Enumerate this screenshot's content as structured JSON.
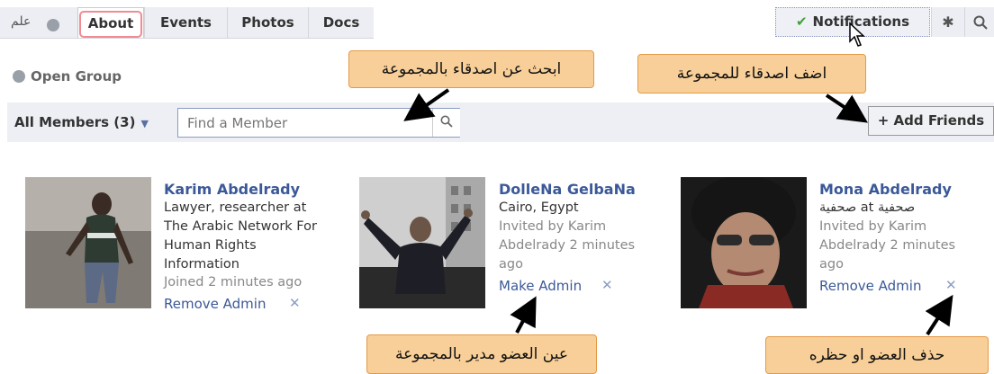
{
  "tabs": {
    "arabic_label": "علم",
    "items": [
      "About",
      "Events",
      "Photos",
      "Docs"
    ],
    "active": "About"
  },
  "notifications": {
    "label": "Notifications"
  },
  "group": {
    "privacy": "Open Group"
  },
  "members_bar": {
    "filter_label": "All Members (3)",
    "search_placeholder": "Find a Member",
    "add_friends_label": "+ Add Friends"
  },
  "callouts": {
    "find_friends": "ابحث عن اصدقاء بالمجموعة",
    "add_friends": "اضف اصدقاء للمجموعة",
    "make_admin": "عين العضو مدير بالمجموعة",
    "remove_member": "حذف العضو او حظره"
  },
  "members": [
    {
      "name": "Karim Abdelrady",
      "lines": [
        "Lawyer, researcher at",
        "The Arabic Network For",
        "Human Rights",
        "Information"
      ],
      "status": "Joined 2 minutes ago",
      "action": "Remove Admin"
    },
    {
      "name": "DolleNa GelbaNa",
      "lines": [
        "Cairo, Egypt"
      ],
      "status_lines": [
        "Invited by Karim",
        "Abdelrady 2 minutes",
        "ago"
      ],
      "action": "Make Admin"
    },
    {
      "name": "Mona Abdelrady",
      "lines": [
        "صحفية at صحفية"
      ],
      "status_lines": [
        "Invited by Karim",
        "Abdelrady 2 minutes",
        "ago"
      ],
      "action": "Remove Admin"
    }
  ],
  "colors": {
    "link": "#3b5998",
    "callout_bg": "#f8cf98",
    "callout_border": "#e49a47",
    "check": "#3fa035"
  }
}
